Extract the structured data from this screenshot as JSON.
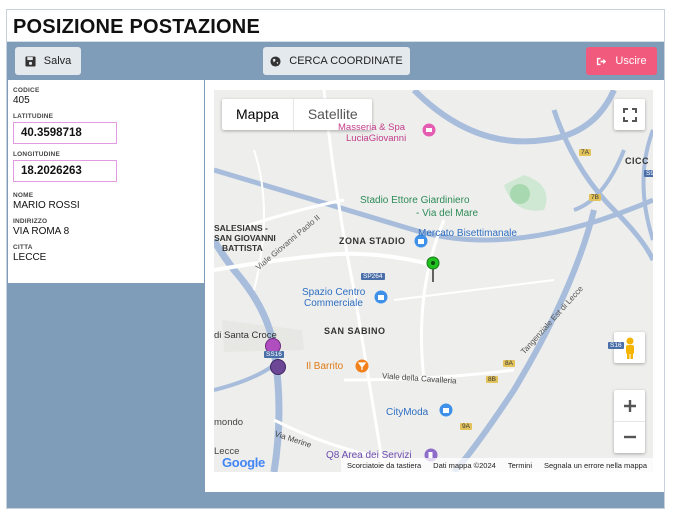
{
  "page": {
    "title": "POSIZIONE POSTAZIONE"
  },
  "toolbar": {
    "save_label": "Salva",
    "search_label": "CERCA COORDINATE",
    "exit_label": "Uscire",
    "exit_color": "#f25a7d"
  },
  "form": {
    "codice": {
      "label": "CODICE",
      "value": "405"
    },
    "latitudine": {
      "label": "LATITUDINE",
      "value": "40.3598718"
    },
    "longitudine": {
      "label": "LONGITUDINE",
      "value": "18.2026263"
    },
    "nome": {
      "label": "NOME",
      "value": "MARIO ROSSI"
    },
    "indirizzo": {
      "label": "INDIRIZZO",
      "value": "VIA ROMA 8"
    },
    "citta": {
      "label": "CITTA",
      "value": "LECCE"
    }
  },
  "map": {
    "type_map": "Mappa",
    "type_satellite": "Satellite",
    "labels": {
      "masseria": "Masseria & Spa",
      "lucia": "LuciaGiovanni",
      "stadio": "Stadio Ettore Giardiniero",
      "via_del_mare": "- Via del Mare",
      "mercato": "Mercato Bisettimanale",
      "zona_stadio": "ZONA STADIO",
      "salesians": "SALESIANS -",
      "san_giovanni": "SAN GIOVANNI",
      "battista": "BATTISTA",
      "spazio": "Spazio Centro",
      "commerciale": "Commerciale",
      "san_sabino": "SAN SABINO",
      "santa_croce": "di Santa Croce",
      "il_barrito": "Il Barrito",
      "cavalleria": "Viale della Cavalleria",
      "citymoda": "CityModa",
      "q8": "Q8 Area dei Servizi",
      "merine": "Via Merine",
      "viale_gp2": "Viale Giovanni Paolo II",
      "tangenziale": "Tangenziale Est di Lecce",
      "cicc": "CICC",
      "mondo": "mondo",
      "lecce": "Lecce",
      "sp264": "SP264",
      "ss16": "SS16",
      "r7a": "7A",
      "r7b": "7B",
      "r8a": "8A",
      "r8b": "8B",
      "r9a": "9A",
      "s9": "S9",
      "s16": "S16"
    },
    "google": "Google",
    "attribution": {
      "shortcuts": "Scorciatoie da tastiera",
      "data": "Dati mappa ©2024",
      "terms": "Termini",
      "report": "Segnala un errore nella mappa"
    },
    "accent_road": "#9bb4d6"
  }
}
